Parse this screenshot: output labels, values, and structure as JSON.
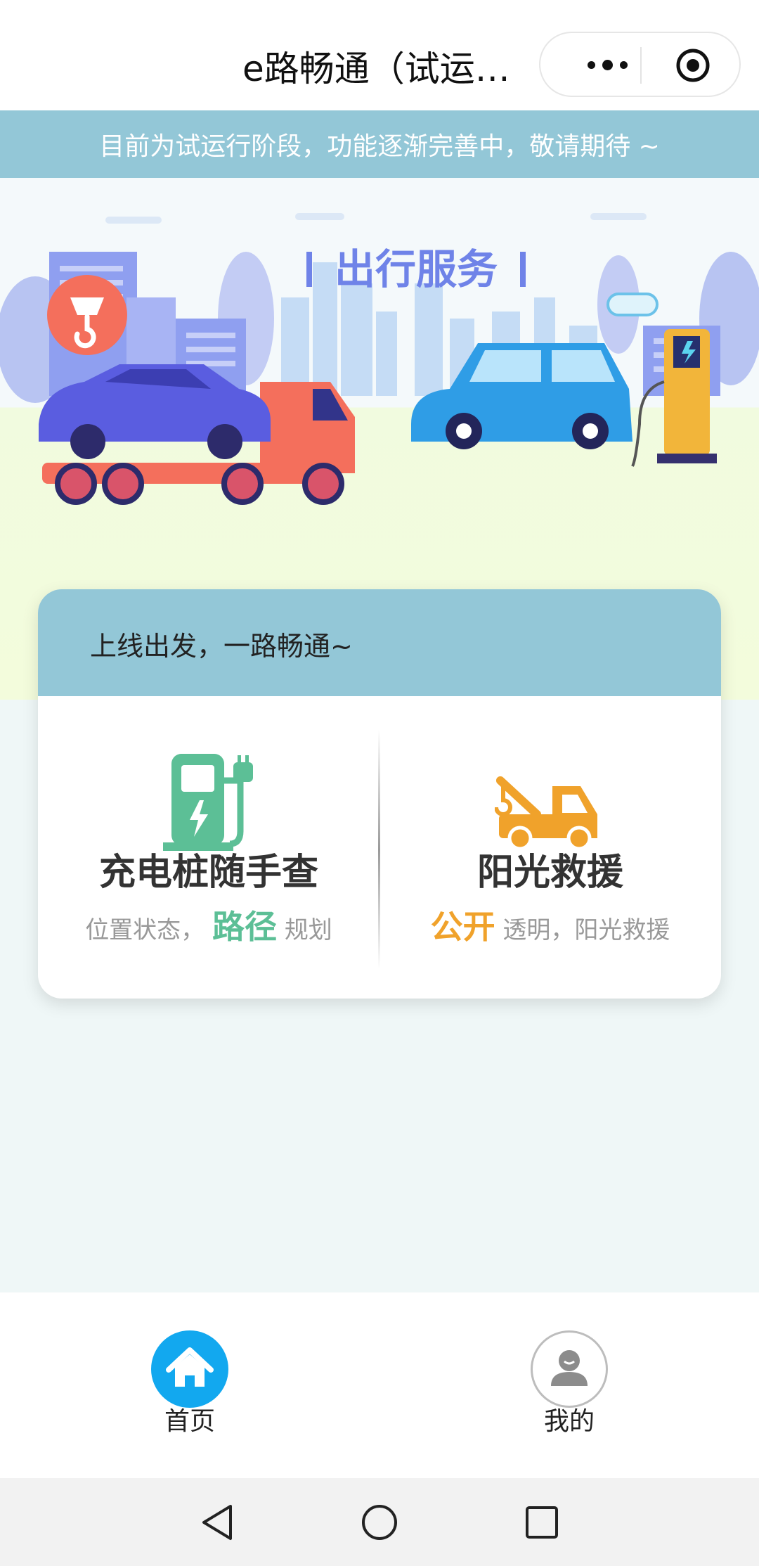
{
  "titlebar": {
    "title": "e路畅通（试运…",
    "more_icon": "more-dots-icon",
    "close_icon": "target-circle-icon"
  },
  "notice": {
    "text": "目前为试运行阶段，功能逐渐完善中，敬请期待 ~"
  },
  "hero": {
    "banner_title": "出行服务"
  },
  "card": {
    "header": "上线出发，一路畅通~",
    "charging": {
      "title": "充电桩随手查",
      "sub_before": "位置状态，",
      "sub_highlight": "路径",
      "sub_after": "规划",
      "icon": "charging-pile-icon"
    },
    "rescue": {
      "title": "阳光救援",
      "sub_highlight": "公开",
      "sub_after": "透明，阳光救援",
      "icon": "tow-truck-icon"
    }
  },
  "tabbar": {
    "home_label": "首页",
    "me_label": "我的"
  },
  "colors": {
    "accent_blue": "#12a8ef",
    "notice_bg": "#93c7d7",
    "green": "#5cbf96",
    "orange": "#f0a22b"
  }
}
